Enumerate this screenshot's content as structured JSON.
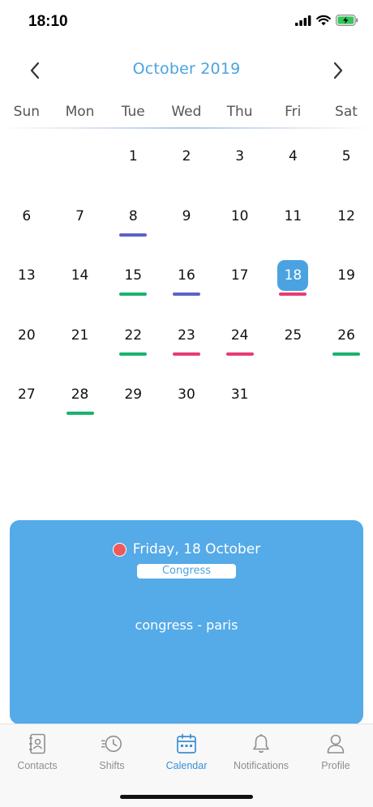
{
  "status_bar": {
    "time": "18:10",
    "icons": [
      "signal-icon",
      "wifi-icon",
      "battery-charging-icon"
    ]
  },
  "calendar": {
    "month_title": "October 2019",
    "prev_icon": "chevron-left-icon",
    "next_icon": "chevron-right-icon",
    "weekdays": [
      "Sun",
      "Mon",
      "Tue",
      "Wed",
      "Thu",
      "Fri",
      "Sat"
    ],
    "days": [
      "1",
      "2",
      "3",
      "4",
      "5",
      "6",
      "7",
      "8",
      "9",
      "10",
      "11",
      "12",
      "13",
      "14",
      "15",
      "16",
      "17",
      "18",
      "19",
      "20",
      "21",
      "22",
      "23",
      "24",
      "25",
      "26",
      "27",
      "28",
      "29",
      "30",
      "31"
    ],
    "selected_day": "18",
    "event_colors": {
      "purple": "#5b63c6",
      "green": "#19b36e",
      "pink": "#e63c78"
    },
    "event_markers": {
      "8": "purple",
      "15": "green",
      "16": "purple",
      "18": "pink",
      "22": "green",
      "23": "pink",
      "24": "pink",
      "26": "green",
      "28": "green"
    }
  },
  "event_card": {
    "date": "Friday, 18 October",
    "badge": "Congress",
    "description": "congress - paris",
    "dot_color": "#ec5a5a",
    "background": "#55aae8"
  },
  "tab_bar": {
    "tabs": [
      {
        "label": "Contacts",
        "icon": "contacts-book-icon"
      },
      {
        "label": "Shifts",
        "icon": "clock-history-icon"
      },
      {
        "label": "Calendar",
        "icon": "calendar-icon"
      },
      {
        "label": "Notifications",
        "icon": "bell-icon"
      },
      {
        "label": "Profile",
        "icon": "person-icon"
      }
    ],
    "active_tab": "Calendar",
    "active_color": "#3a8fd4",
    "inactive_color": "#8e8e8e"
  }
}
